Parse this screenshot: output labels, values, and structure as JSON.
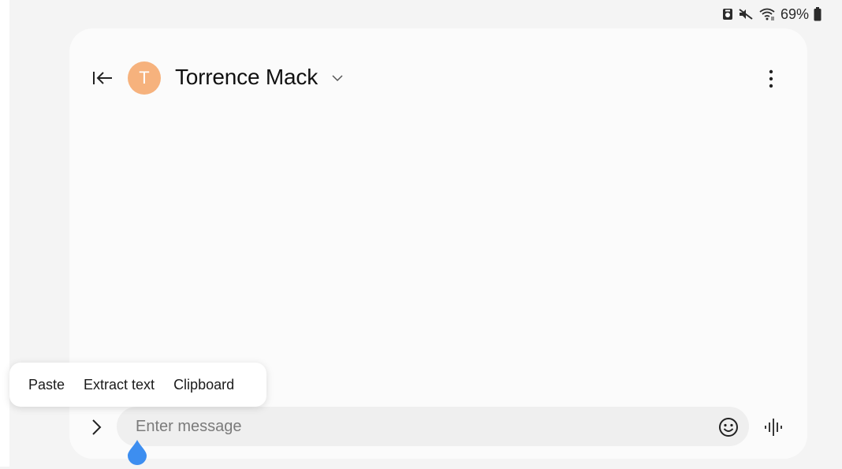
{
  "status_bar": {
    "battery_percent": "69%",
    "icons": [
      "screenshot-icon",
      "mute-icon",
      "wifi-icon",
      "battery-icon"
    ]
  },
  "conversation": {
    "contact_name": "Torrence Mack",
    "avatar_initial": "T",
    "avatar_color": "#f6b27d"
  },
  "context_menu": {
    "items": [
      "Paste",
      "Extract text",
      "Clipboard"
    ]
  },
  "composer": {
    "placeholder": "Enter message",
    "value": ""
  },
  "colors": {
    "background": "#f4f4f4",
    "panel": "#fbfbfb",
    "input_background": "#efefef",
    "cursor_handle": "#3d8ef0"
  }
}
